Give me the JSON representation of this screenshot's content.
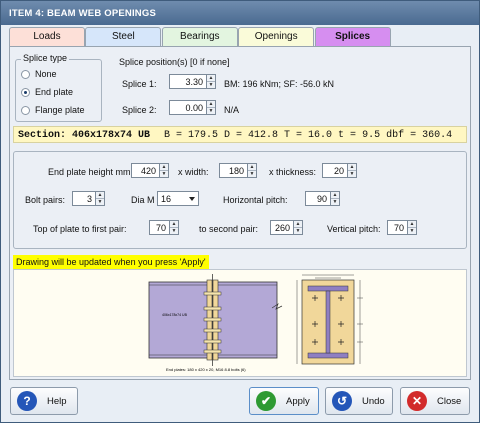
{
  "window": {
    "title": "ITEM 4: BEAM WEB OPENINGS"
  },
  "tabs": [
    "Loads",
    "Steel",
    "Bearings",
    "Openings",
    "Splices"
  ],
  "active_tab": "Splices",
  "splice_type": {
    "legend": "Splice type",
    "options": [
      "None",
      "End plate",
      "Flange plate"
    ],
    "selected": "End plate"
  },
  "splice_position": {
    "header": "Splice position(s) [0 if none]",
    "splice1_label": "Splice 1:",
    "splice1_value": "3.30",
    "splice1_info": "BM: 196 kNm; SF: -56.0 kN",
    "splice2_label": "Splice 2:",
    "splice2_value": "0.00",
    "splice2_info": "N/A"
  },
  "section": {
    "name": "Section: 406x178x74 UB",
    "dims": "B = 179.5  D = 412.8  T = 16.0  t = 9.5  dbf = 360.4"
  },
  "params": {
    "height_label": "End plate height mm:",
    "height_value": "420",
    "width_label": "x width:",
    "width_value": "180",
    "thickness_label": "x thickness:",
    "thickness_value": "20",
    "bolt_pairs_label": "Bolt pairs:",
    "bolt_pairs_value": "3",
    "dia_label": "Dia M",
    "dia_value": "16",
    "hpitch_label": "Horizontal pitch:",
    "hpitch_value": "90",
    "top_first_label": "Top of plate to first pair:",
    "top_first_value": "70",
    "second_pair_label": "to second pair:",
    "second_pair_value": "260",
    "vpitch_label": "Vertical pitch:",
    "vpitch_value": "70"
  },
  "notice": "Drawing will be updated when you press 'Apply'",
  "drawing": {
    "beam_label": "406x178x74 UB",
    "caption": "End plates: 180 x 420 x 20,  M16 8.8 bolts (6)"
  },
  "buttons": {
    "help": "Help",
    "apply": "Apply",
    "undo": "Undo",
    "close": "Close"
  },
  "colors": {
    "titlebar": "#4f6f94",
    "active_tab": "#d68ef0",
    "section_bar": "#fff7c2",
    "notice": "#ffff00",
    "beam": "#b3a8d6",
    "plate": "#f1d79a"
  }
}
